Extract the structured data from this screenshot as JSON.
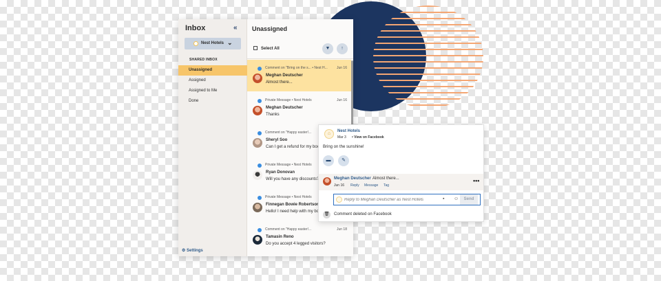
{
  "sidebar": {
    "title": "Inbox",
    "collapse_icon": "«",
    "account": "Nest Hotels",
    "shared_label": "SHARED INBOX",
    "items": [
      {
        "label": "Unassigned"
      },
      {
        "label": "Assigned"
      },
      {
        "label": "Assigned to Me"
      },
      {
        "label": "Done"
      }
    ],
    "settings": "⚙ Settings"
  },
  "list": {
    "title": "Unassigned",
    "select_all": "Select All",
    "filter_icon": "filter-icon",
    "sort_icon": "sort-up-icon",
    "items": [
      {
        "meta": "Comment on \"Bring on the s...  •  Nest H...",
        "date": "Jun 16",
        "name": "Meghan Deutscher",
        "text": "Almost there...",
        "avatar_color": "#c4502b"
      },
      {
        "meta": "Private Message  •  Nest Hotels",
        "date": "Jun 16",
        "name": "Meghan Deutscher",
        "text": "Thanks",
        "avatar_color": "#c4502b"
      },
      {
        "meta": "Comment on \"Happy easter!...",
        "date": "",
        "name": "Sheryl Soo",
        "text": "Can I get a refund for my book",
        "avatar_color": "#b09685"
      },
      {
        "meta": "Private Message  •  Nest Hotels",
        "date": "",
        "name": "Ryan Donovan",
        "text": "Will you have any discounts?",
        "avatar_color": "#6a6a6a"
      },
      {
        "meta": "Private Message  •  Nest Hotels",
        "date": "",
        "name": "Finnegan Bowie Robertson",
        "text": "Hello! I need help with my book",
        "avatar_color": "#7b6a5a"
      },
      {
        "meta": "Comment on \"Happy easter!...",
        "date": "Jun 18",
        "name": "Tamasin Reno",
        "text": "Do you accept 4 legged visitors?",
        "avatar_color": "#1c2a3a"
      }
    ]
  },
  "card": {
    "page_name": "Nest Hotels",
    "date": "Mar 3",
    "view_link": "•  View on Facebook",
    "post_text": "Bring on the sunshine!",
    "comment": {
      "author": "Meghan Deutscher",
      "text": "Almost there...",
      "date": "Jun 16",
      "actions": [
        "Reply",
        "Message",
        "Tag"
      ]
    },
    "reply_placeholder": "Reply to Meghan Deutscher as Nest Hotels",
    "send_label": "Send",
    "deleted_text": "Comment deleted on Facebook"
  },
  "colors": {
    "accent": "#f7c56a",
    "link": "#2f5b8a",
    "deco_navy": "#1c3560",
    "deco_orange": "#f4a673"
  }
}
